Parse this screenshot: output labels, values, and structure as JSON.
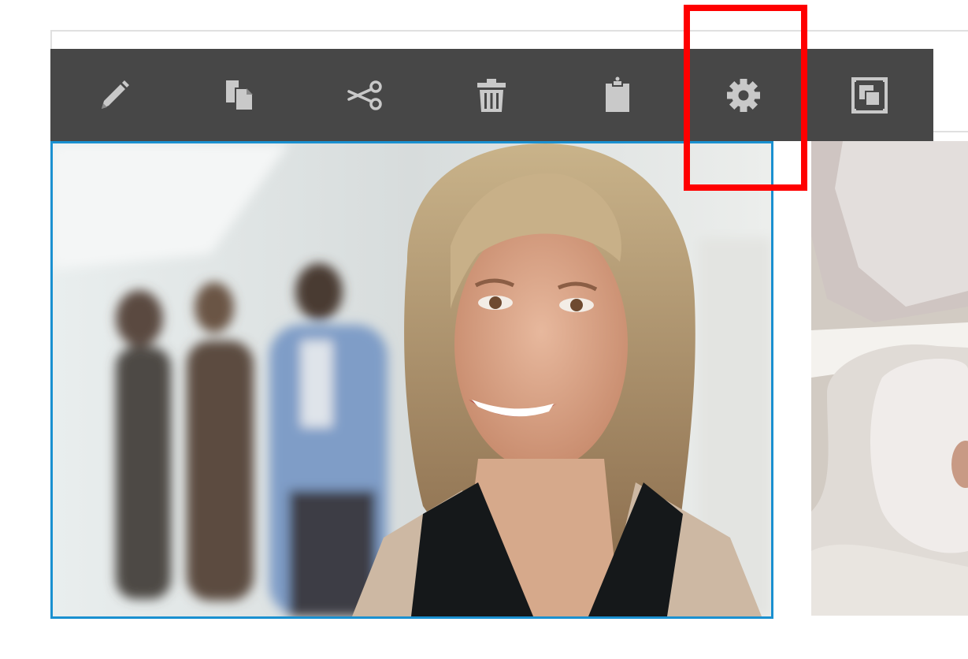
{
  "toolbar": {
    "background": "#474747",
    "icon_color": "#c9c9c9",
    "tools": [
      {
        "id": "edit",
        "icon": "pencil-icon"
      },
      {
        "id": "copy",
        "icon": "copy-icon"
      },
      {
        "id": "cut",
        "icon": "scissors-icon"
      },
      {
        "id": "delete",
        "icon": "trash-icon"
      },
      {
        "id": "paste",
        "icon": "clipboard-icon"
      },
      {
        "id": "settings",
        "icon": "gear-icon",
        "highlighted": true
      },
      {
        "id": "layers",
        "icon": "layers-icon"
      }
    ]
  },
  "selection": {
    "border_color": "#1a90d0",
    "image": "smiling-businesswoman-photo"
  },
  "adjacent_image": "person-in-white-protective-mask-photo",
  "annotation": {
    "color": "#ff0000",
    "target": "gear-icon"
  }
}
